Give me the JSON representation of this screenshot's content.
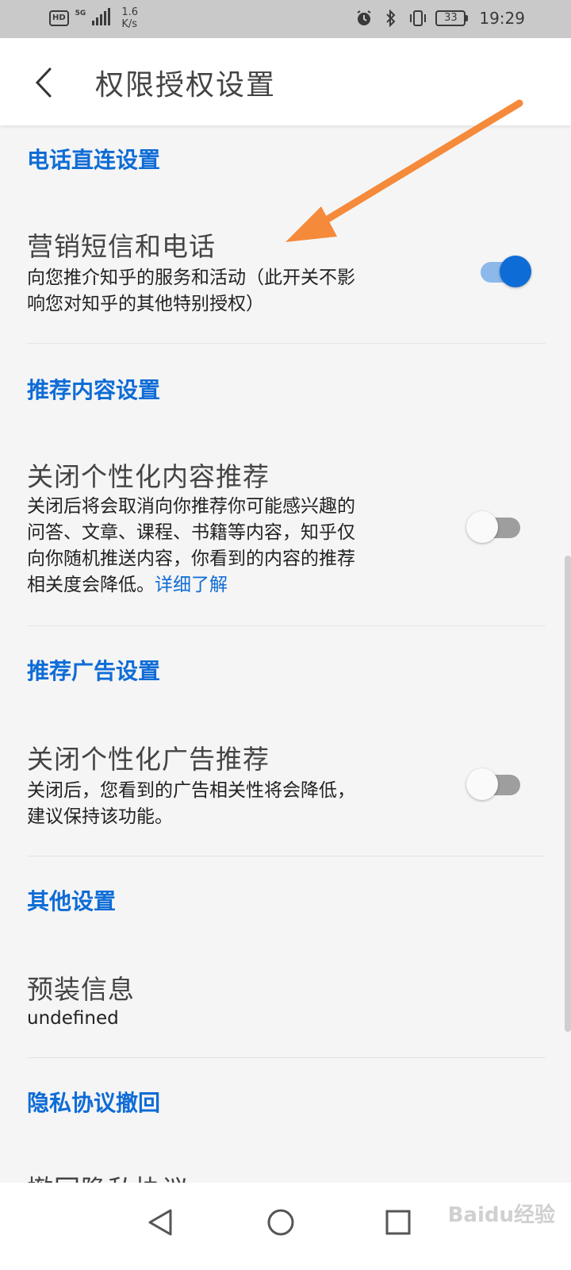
{
  "status_bar": {
    "hd": "HD",
    "net": "5G",
    "speed_value": "1.6",
    "speed_unit": "K/s",
    "battery": "33",
    "time": "19:29",
    "icons": [
      "alarm-icon",
      "bluetooth-icon",
      "vibrate-icon",
      "battery-icon"
    ]
  },
  "header": {
    "back_icon": "chevron-left-icon",
    "title": "权限授权设置"
  },
  "sections": {
    "phone": {
      "title": "电话直连设置",
      "item_title": "营销短信和电话",
      "desc_line1": "向您推介知乎的服务和活动（此开关不影",
      "desc_line2": "响您对知乎的其他特别授权）",
      "toggle_on": true
    },
    "content": {
      "title": "推荐内容设置",
      "item_title": "关闭个性化内容推荐",
      "desc_line1": "关闭后将会取消向你推荐你可能感兴趣的",
      "desc_line2": "问答、文章、课程、书籍等内容，知乎仅",
      "desc_line3": "向你随机推送内容，你看到的内容的推荐",
      "desc_line4": "相关度会降低。",
      "link": "详细了解",
      "toggle_on": false
    },
    "ads": {
      "title": "推荐广告设置",
      "item_title": "关闭个性化广告推荐",
      "desc_line1": "关闭后，您看到的广告相关性将会降低，",
      "desc_line2": "建议保持该功能。",
      "toggle_on": false
    },
    "other": {
      "title": "其他设置",
      "item_title": "预装信息",
      "value": "undefined"
    },
    "privacy": {
      "title": "隐私协议撤回",
      "item_title_partial": "撤回隐私协议"
    }
  },
  "colors": {
    "accent": "#0e6cd6",
    "annotation_arrow": "#f58a3a"
  },
  "nav_bar": {
    "back": "triangle-back-icon",
    "home": "circle-home-icon",
    "recents": "square-recents-icon",
    "watermark": "Baidu经验"
  }
}
